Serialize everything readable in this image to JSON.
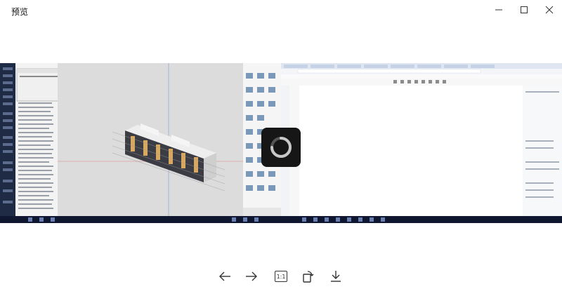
{
  "window": {
    "title": "预览",
    "controls": {
      "minimize_icon": "minimize-icon",
      "maximize_icon": "maximize-icon",
      "close_icon": "close-icon"
    }
  },
  "toolbar": {
    "zoom_actual_label": "1:1",
    "buttons": [
      {
        "name": "previous-button",
        "icon": "arrow-left-icon"
      },
      {
        "name": "next-button",
        "icon": "arrow-right-icon"
      },
      {
        "name": "actual-size-button",
        "icon": "one-to-one-icon"
      },
      {
        "name": "rotate-button",
        "icon": "rotate-icon"
      },
      {
        "name": "download-button",
        "icon": "download-icon"
      }
    ]
  },
  "preview": {
    "loading_icon": "loading-spinner-icon"
  },
  "colors": {
    "spinner_bg": "#161616",
    "spinner_ring": "#c8c8c8",
    "taskbar": "#0f1730"
  }
}
